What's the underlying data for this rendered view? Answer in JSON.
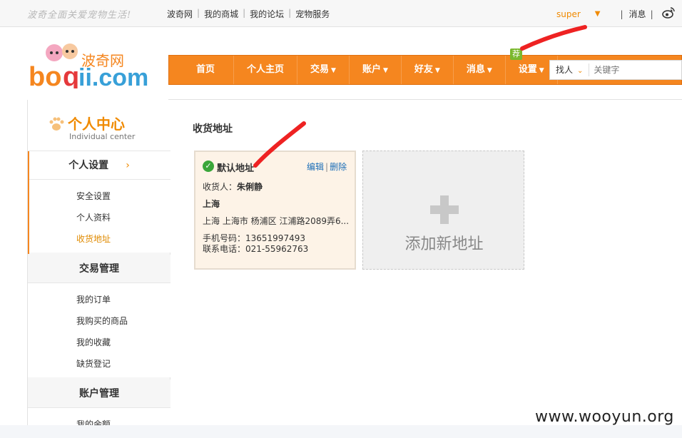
{
  "topbar": {
    "slogan": "波奇全面关爱宠物生活!",
    "links": [
      "波奇网",
      "我的商城",
      "我的论坛",
      "宠物服务"
    ],
    "username": "super",
    "message": "消息"
  },
  "logo": {
    "cn": "波奇网",
    "en": "boqii.com"
  },
  "nav": {
    "items": [
      {
        "label": "首页",
        "dropdown": false
      },
      {
        "label": "个人主页",
        "dropdown": false
      },
      {
        "label": "交易",
        "dropdown": true
      },
      {
        "label": "账户",
        "dropdown": true
      },
      {
        "label": "好友",
        "dropdown": true
      },
      {
        "label": "消息",
        "dropdown": true
      },
      {
        "label": "设置",
        "dropdown": true
      }
    ],
    "badge": "荐"
  },
  "search": {
    "type": "找人",
    "placeholder": "关键字"
  },
  "sidebar": {
    "title": "个人中心",
    "subtitle": "Individual center",
    "sections": [
      {
        "title": "个人设置",
        "items": [
          "安全设置",
          "个人资料",
          "收货地址"
        ]
      },
      {
        "title": "交易管理",
        "items": [
          "我的订单",
          "我购买的商品",
          "我的收藏",
          "缺货登记"
        ]
      },
      {
        "title": "账户管理",
        "items": [
          "我的余额"
        ]
      }
    ]
  },
  "content": {
    "title": "收货地址",
    "address": {
      "default_label": "默认地址",
      "edit": "编辑",
      "delete": "删除",
      "consignee_label": "收货人：",
      "consignee": "朱俐静",
      "province": "上海",
      "detail": "上海 上海市 杨浦区 江浦路2089弄6...",
      "mobile": "手机号码：13651997493",
      "phone": "联系电话：021-55962763"
    },
    "add_label": "添加新地址"
  },
  "watermark": "www.wooyun.org",
  "colors": {
    "accent": "#f5861f",
    "link": "#1d6fb8",
    "annotation": "#ee2222"
  }
}
